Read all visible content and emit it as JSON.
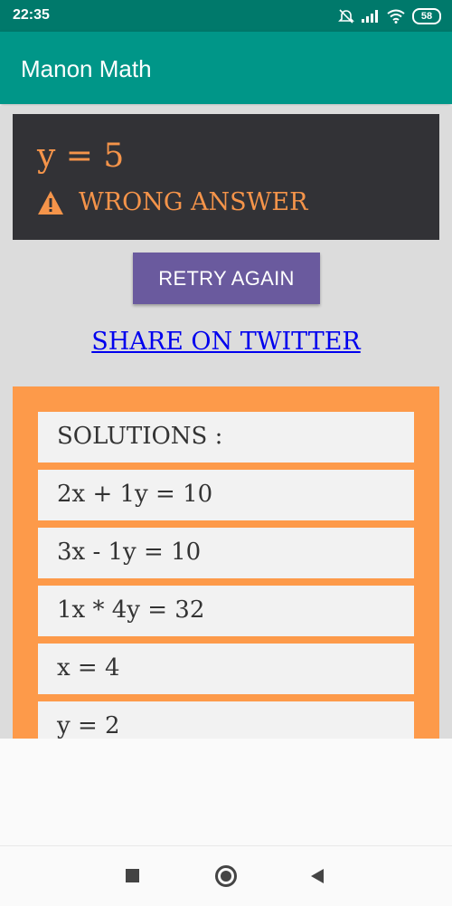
{
  "status_bar": {
    "time": "22:35",
    "battery": "58",
    "icons": [
      "alarm-off-icon",
      "signal-icon",
      "wifi-icon",
      "battery-icon"
    ]
  },
  "app_bar": {
    "title": "Manon Math",
    "color": "#009688"
  },
  "result": {
    "value": "y = 5",
    "status": "WRONG ANSWER",
    "status_icon": "warning-icon",
    "accent": "#f5944a"
  },
  "actions": {
    "retry_label": "RETRY AGAIN",
    "share_label": "SHARE ON TWITTER"
  },
  "solutions": {
    "header": "SOLUTIONS :",
    "items": [
      "2x + 1y = 10",
      "3x - 1y = 10",
      "1x * 4y = 32",
      "x = 4",
      "y = 2"
    ]
  },
  "nav": {
    "icons": [
      "recents-icon",
      "home-icon",
      "back-icon"
    ]
  }
}
